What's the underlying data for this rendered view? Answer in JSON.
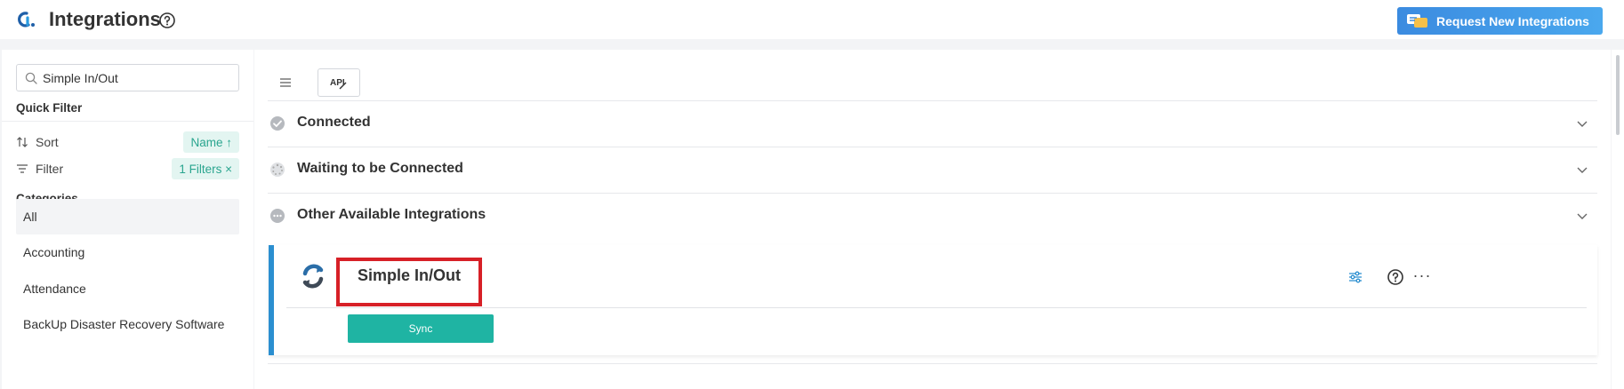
{
  "header": {
    "title": "Integrations",
    "request_button": "Request New Integrations"
  },
  "sidebar": {
    "search": {
      "value": "Simple In/Out",
      "placeholder": "Search"
    },
    "quick_filter_title": "Quick Filter",
    "sort_label": "Sort",
    "sort_chip": "Name ↑",
    "filter_label": "Filter",
    "filter_chip": "1 Filters ×",
    "categories_title": "Categories",
    "categories": [
      "All",
      "Accounting",
      "Attendance",
      "BackUp Disaster Recovery Software"
    ],
    "selected_category": "All"
  },
  "main": {
    "view_api_label": "API",
    "groups": [
      {
        "label": "Connected",
        "icon": "check-circle-icon"
      },
      {
        "label": "Waiting to be Connected",
        "icon": "loading-icon"
      },
      {
        "label": "Other Available Integrations",
        "icon": "more-circle-icon"
      }
    ],
    "card": {
      "name": "Simple In/Out",
      "sync_button": "Sync",
      "more_label": "···"
    }
  },
  "colors": {
    "accent_teal": "#1fb4a3",
    "card_border": "#2b8fd0",
    "highlight": "#d72027",
    "request_button": "#3b8be0"
  }
}
